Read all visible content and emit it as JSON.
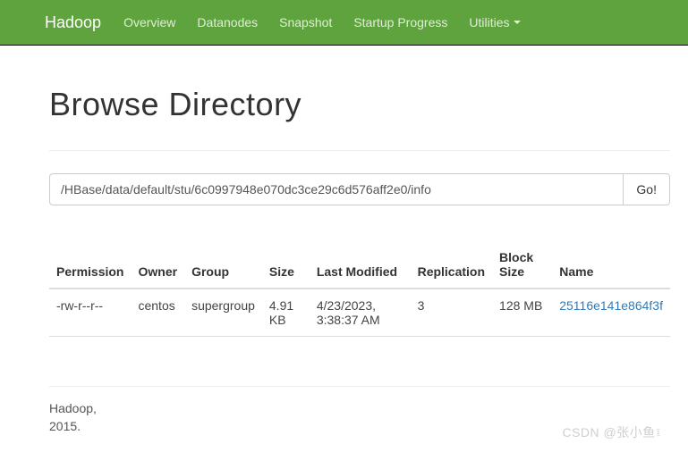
{
  "navbar": {
    "brand": "Hadoop",
    "items": [
      {
        "label": "Overview"
      },
      {
        "label": "Datanodes"
      },
      {
        "label": "Snapshot"
      },
      {
        "label": "Startup Progress"
      },
      {
        "label": "Utilities",
        "dropdown": true
      }
    ]
  },
  "page_title": "Browse Directory",
  "path_input": {
    "value": "/HBase/data/default/stu/6c0997948e070dc3ce29c6d576aff2e0/info"
  },
  "go_button_label": "Go!",
  "table": {
    "headers": {
      "permission": "Permission",
      "owner": "Owner",
      "group": "Group",
      "size": "Size",
      "last_modified": "Last Modified",
      "replication": "Replication",
      "block_size": "Block Size",
      "name": "Name"
    },
    "rows": [
      {
        "permission": "-rw-r--r--",
        "owner": "centos",
        "group": "supergroup",
        "size": "4.91 KB",
        "last_modified": "4/23/2023, 3:38:37 AM",
        "replication": "3",
        "block_size": "128 MB",
        "name": "25116e141e864f3f"
      }
    ]
  },
  "footer": {
    "line1": "Hadoop,",
    "line2": "2015."
  },
  "watermark": "CSDN @张小鱼፤"
}
